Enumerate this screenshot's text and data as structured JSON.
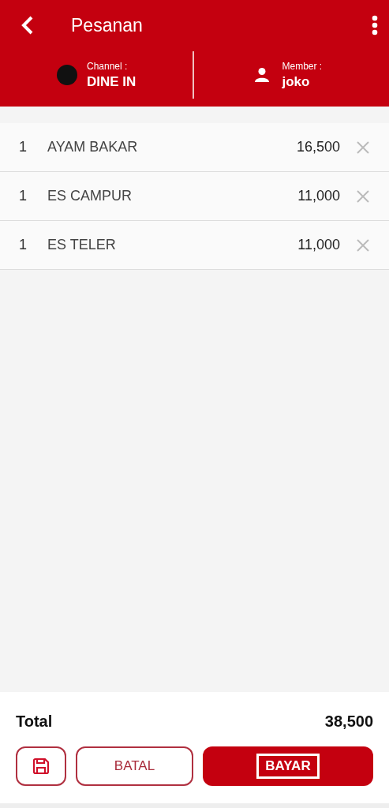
{
  "header": {
    "title": "Pesanan",
    "channel": {
      "label": "Channel :",
      "value": "DINE IN"
    },
    "member": {
      "label": "Member :",
      "value": "joko"
    }
  },
  "items": [
    {
      "qty": "1",
      "name": "AYAM BAKAR",
      "price": "16,500"
    },
    {
      "qty": "1",
      "name": "ES CAMPUR",
      "price": "11,000"
    },
    {
      "qty": "1",
      "name": "ES TELER",
      "price": "11,000"
    }
  ],
  "footer": {
    "total_label": "Total",
    "total": "38,500",
    "cancel": "BATAL",
    "pay": "BAYAR"
  }
}
